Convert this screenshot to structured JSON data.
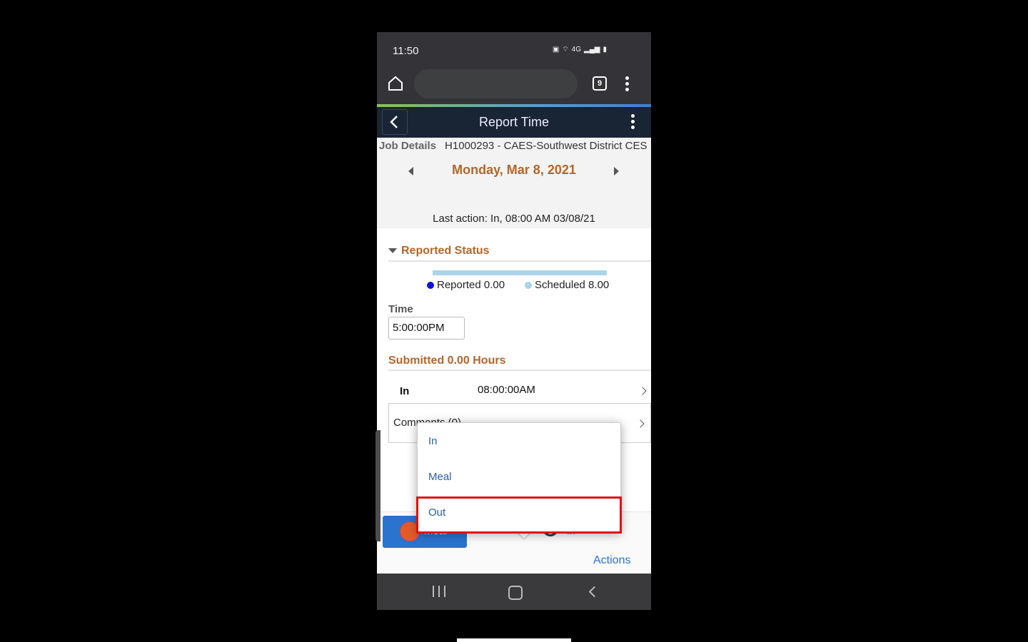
{
  "status_bar": {
    "time": "11:50",
    "network": "4G"
  },
  "browser": {
    "tab_count": "9"
  },
  "app_header": {
    "title": "Report Time"
  },
  "job_details": {
    "label": "Job Details",
    "value": "H1000293 - CAES-Southwest District CES"
  },
  "date_nav": {
    "date": "Monday, Mar 8, 2021"
  },
  "last_action": "Last action: In, 08:00 AM 03/08/21",
  "reported_status": {
    "heading": "Reported Status",
    "legend": [
      {
        "label": "Reported 0.00",
        "color": "#0a14e0"
      },
      {
        "label": "Scheduled 8.00",
        "color": "#a9d4ea"
      }
    ],
    "reported_hours": 0.0,
    "scheduled_hours": 8.0
  },
  "time_field": {
    "label": "Time",
    "value": "5:00:00PM"
  },
  "submitted": {
    "heading": "Submitted 0.00 Hours",
    "rows": [
      {
        "type": "In",
        "time": "08:00:00AM"
      }
    ],
    "comments_label": "Comments (0)"
  },
  "footer": {
    "meal_button": "Meal",
    "in_button": "In",
    "actions": "Actions"
  },
  "popup_menu": {
    "items": [
      "In",
      "Meal",
      "Out"
    ],
    "highlighted": "Out"
  }
}
